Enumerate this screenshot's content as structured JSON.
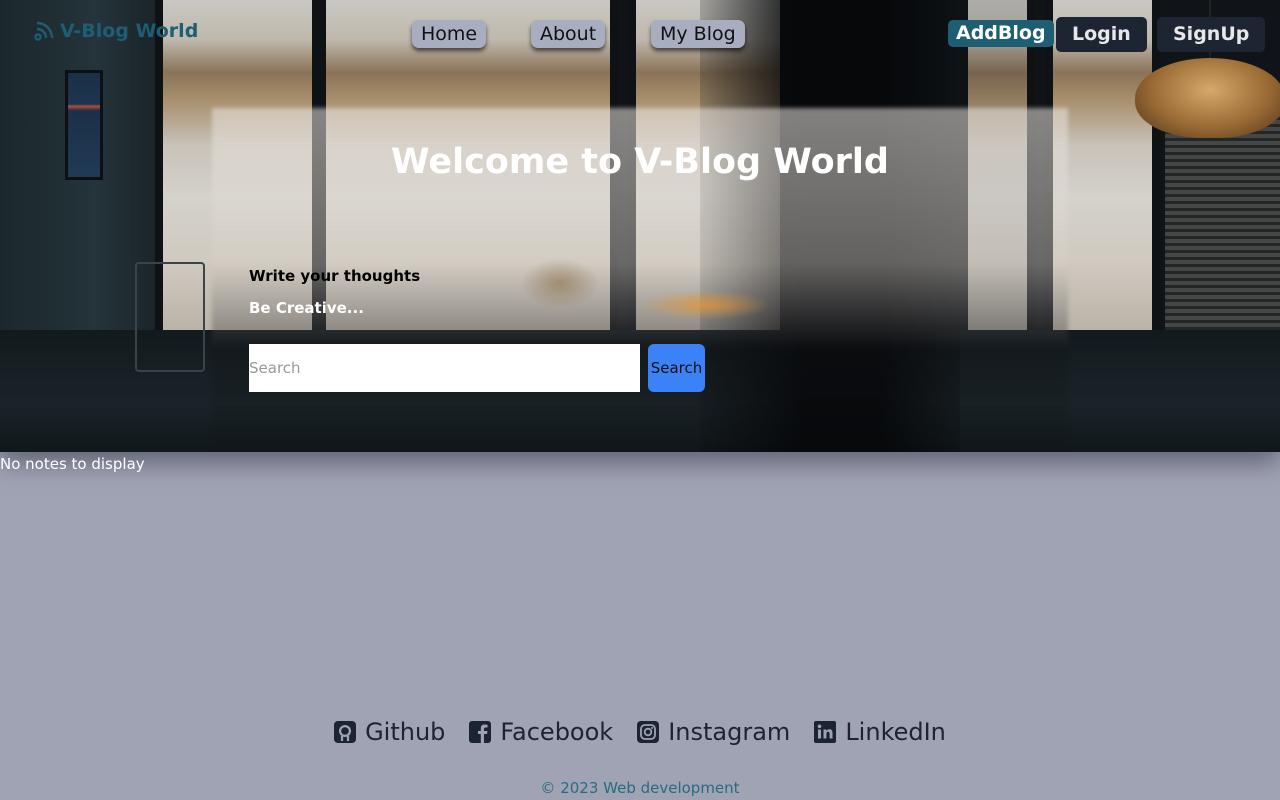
{
  "brand": {
    "name": "V-Blog World",
    "icon": "rss-feed-icon"
  },
  "nav": {
    "home": "Home",
    "about": "About",
    "my_blog": "My Blog"
  },
  "actions": {
    "add_blog": "AddBlog",
    "login": "Login",
    "signup": "SignUp"
  },
  "hero": {
    "title": "Welcome to V-Blog World",
    "tagline_1": "Write your thoughts",
    "tagline_2": "Be Creative...",
    "search_placeholder": "Search",
    "search_button": "Search"
  },
  "notes": {
    "empty_message": "No notes to display"
  },
  "footer": {
    "socials": [
      {
        "label": "Github",
        "icon": "github-icon"
      },
      {
        "label": "Facebook",
        "icon": "facebook-icon"
      },
      {
        "label": "Instagram",
        "icon": "instagram-icon"
      },
      {
        "label": "LinkedIn",
        "icon": "linkedin-icon"
      }
    ],
    "copyright": "© 2023 Web development"
  },
  "colors": {
    "page_bg": "#a0a3b4",
    "brand": "#1d5e74",
    "nav_pill": "#a9adc0",
    "dark_button": "#1d2533",
    "search_button": "#3b82f6"
  }
}
